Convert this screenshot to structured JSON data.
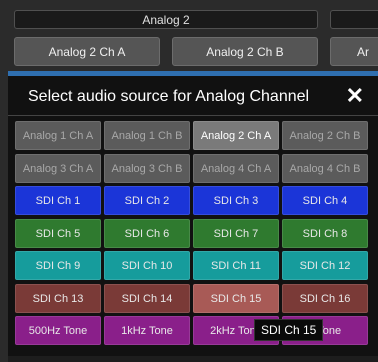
{
  "top_tabs": [
    {
      "label": "Analog 2"
    },
    {
      "label": ""
    }
  ],
  "channel_buttons": [
    {
      "label": "Analog 2 Ch A"
    },
    {
      "label": "Analog 2 Ch B"
    },
    {
      "label": "Ar"
    }
  ],
  "dialog": {
    "title": "Select audio source for Analog Channel",
    "close_icon": "✕"
  },
  "sources": [
    [
      "Analog 1 Ch A",
      "Analog 1 Ch B",
      "Analog 2 Ch A",
      "Analog 2 Ch B"
    ],
    [
      "Analog 3 Ch A",
      "Analog 3 Ch B",
      "Analog 4 Ch A",
      "Analog 4 Ch B"
    ],
    [
      "SDI Ch 1",
      "SDI Ch 2",
      "SDI Ch 3",
      "SDI Ch 4"
    ],
    [
      "SDI Ch 5",
      "SDI Ch 6",
      "SDI Ch 7",
      "SDI Ch 8"
    ],
    [
      "SDI Ch 9",
      "SDI Ch 10",
      "SDI Ch 11",
      "SDI Ch 12"
    ],
    [
      "SDI Ch 13",
      "SDI Ch 14",
      "SDI Ch 15",
      "SDI Ch 16"
    ],
    [
      "500Hz Tone",
      "1kHz Tone",
      "2kHz Tone",
      "z Tone"
    ]
  ],
  "row_colors": [
    "#5b5b5b",
    "#5b5b5b",
    "#1b35d8",
    "#2f7a2f",
    "#169c9c",
    "#7a3a37",
    "#8a1f8a"
  ],
  "selected_source": "Analog 2 Ch A",
  "hovered_source": "SDI Ch 15",
  "tooltip": "SDI Ch 15"
}
